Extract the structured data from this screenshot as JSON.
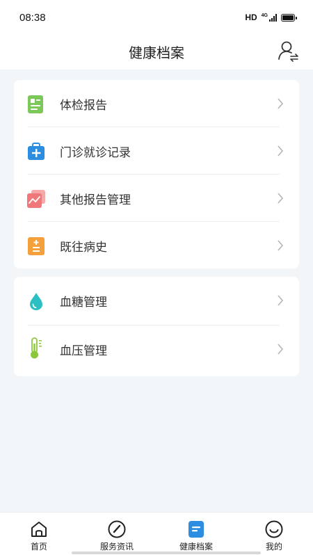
{
  "status_bar": {
    "time": "08:38",
    "hd_label": "HD",
    "network_label": "4G"
  },
  "header": {
    "title": "健康档案",
    "profile_switch_icon": "user-switch-icon"
  },
  "card1": {
    "items": [
      {
        "label": "体检报告",
        "icon": "report-icon",
        "color": "#7cc85a"
      },
      {
        "label": "门诊就诊记录",
        "icon": "medical-kit-icon",
        "color": "#2d8de0"
      },
      {
        "label": "其他报告管理",
        "icon": "chart-report-icon",
        "color": "#f0787a"
      },
      {
        "label": "既往病史",
        "icon": "history-icon",
        "color": "#f5a13b"
      }
    ]
  },
  "card2": {
    "items": [
      {
        "label": "血糖管理",
        "icon": "blood-drop-icon",
        "color": "#2bbfc4"
      },
      {
        "label": "血压管理",
        "icon": "thermometer-icon",
        "color": "#8cc63f"
      }
    ]
  },
  "tabbar": {
    "tabs": [
      {
        "label": "首页",
        "icon": "home-icon"
      },
      {
        "label": "服务资讯",
        "icon": "compass-icon"
      },
      {
        "label": "健康档案",
        "icon": "health-record-icon",
        "active": true,
        "color": "#2d8de0"
      },
      {
        "label": "我的",
        "icon": "smile-icon"
      }
    ]
  }
}
